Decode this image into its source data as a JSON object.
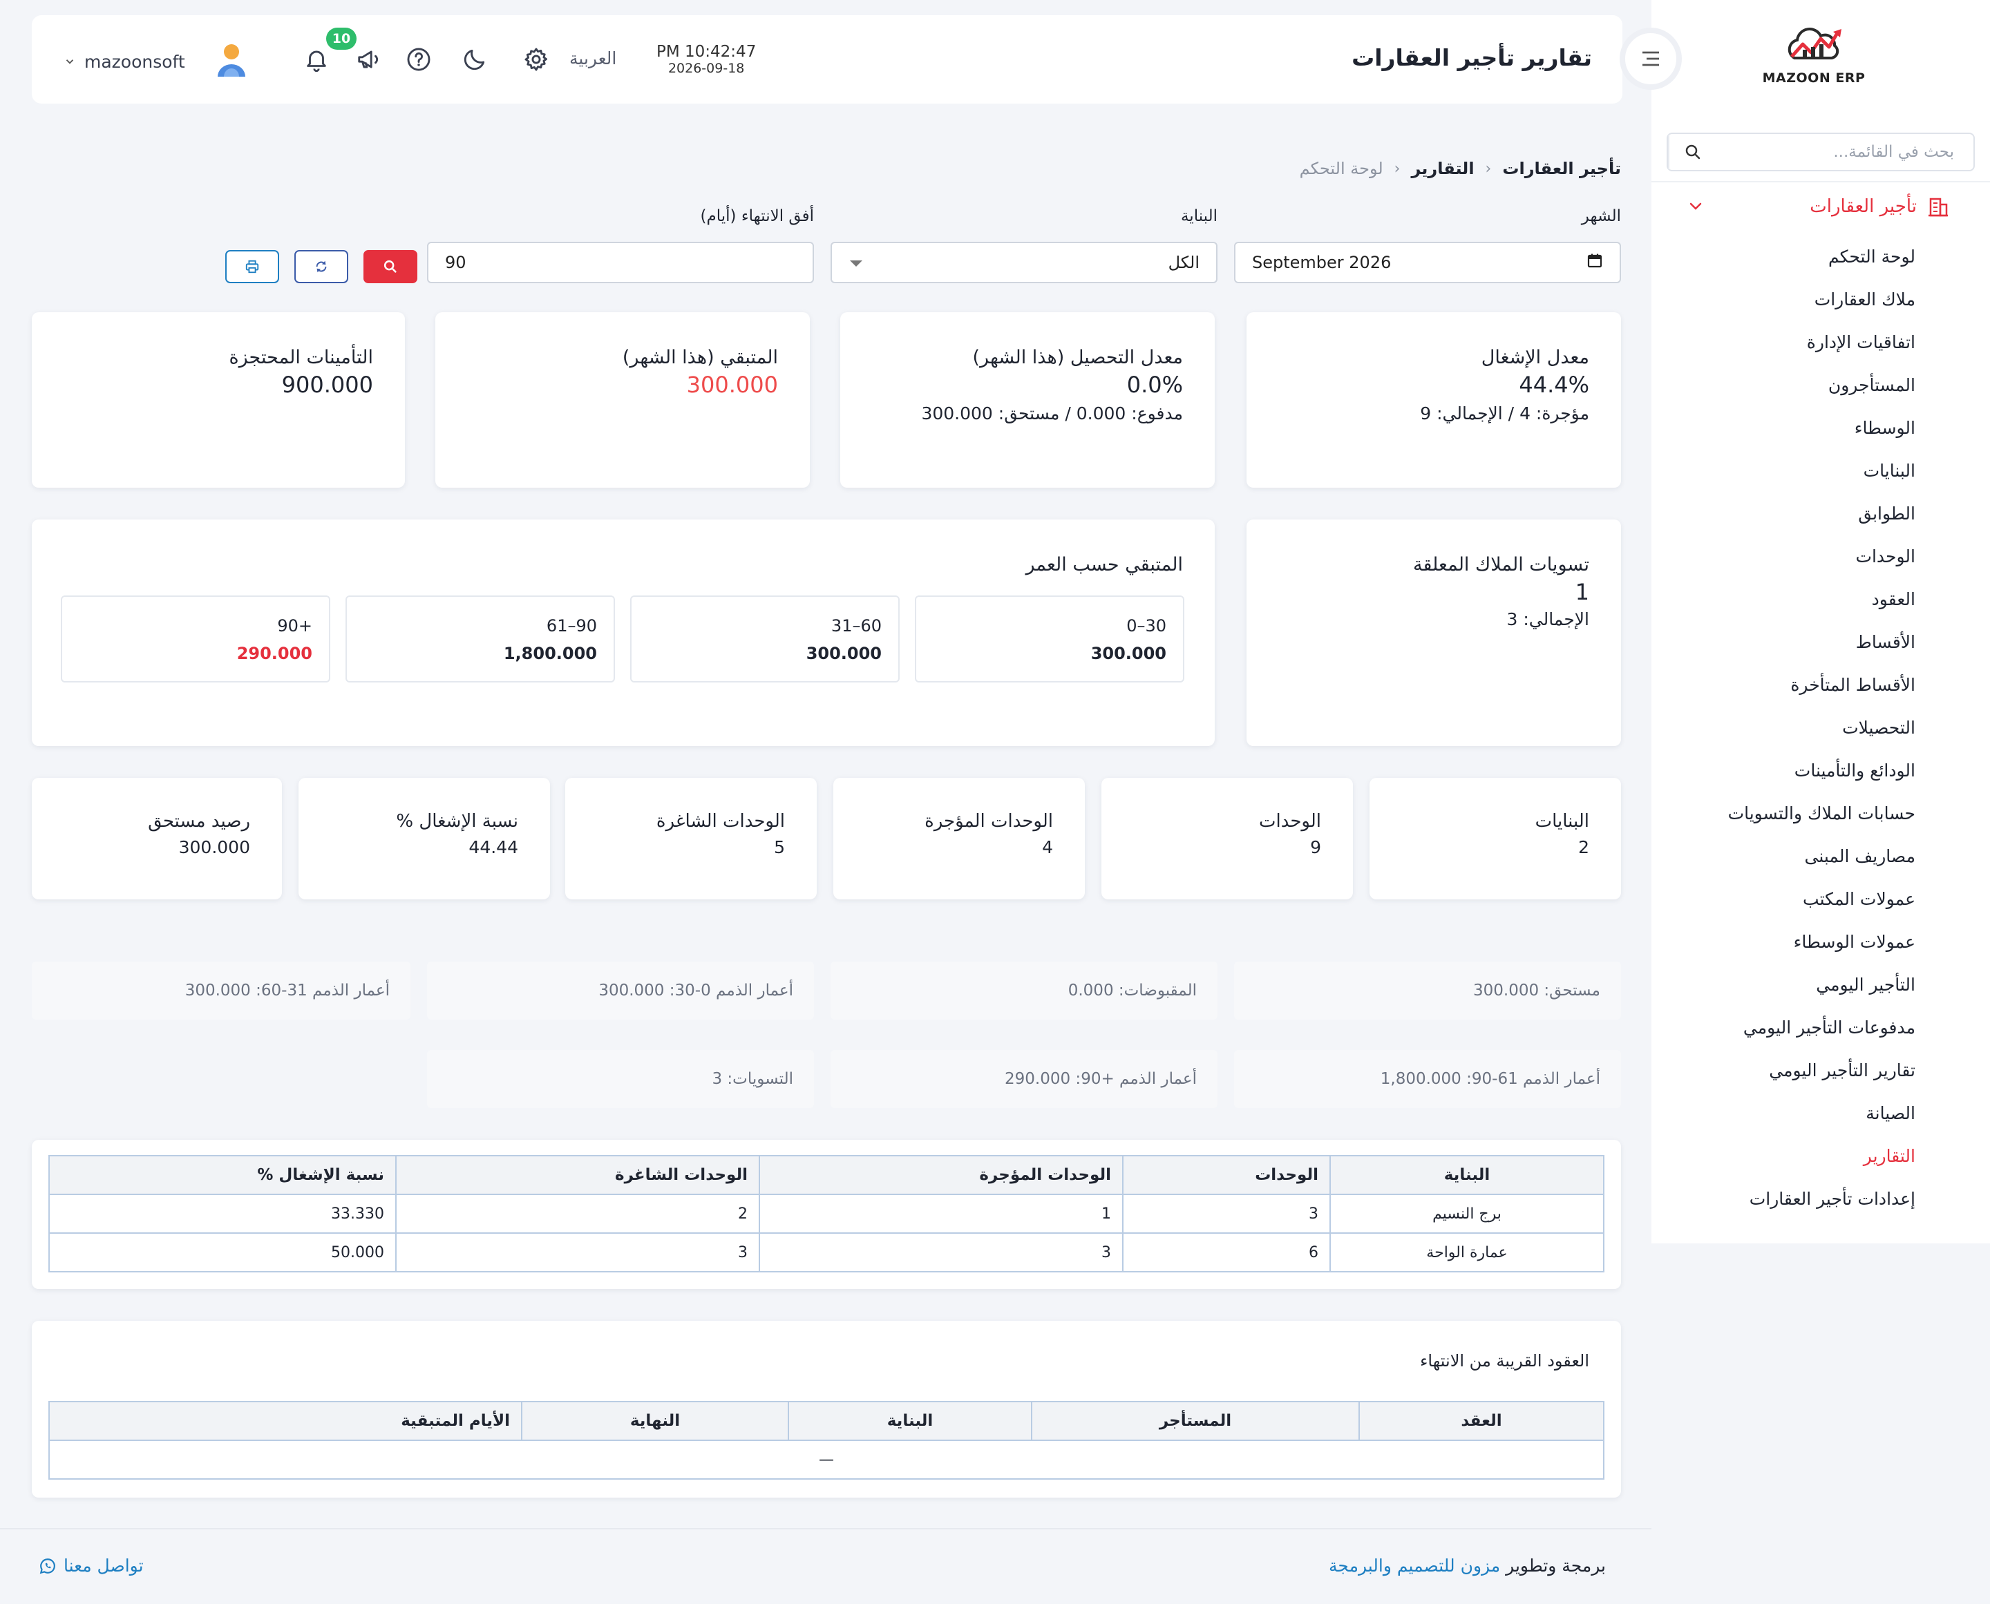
{
  "app": {
    "logo_text": "MAZOON ERP",
    "accent": "#e5303d",
    "link_color": "#1e7fc2"
  },
  "sidebar": {
    "search_placeholder": "بحث في القائمة...",
    "group_label": "تأجير العقارات",
    "items": [
      {
        "label": "لوحة التحكم",
        "active": false
      },
      {
        "label": "ملاك العقارات",
        "active": false
      },
      {
        "label": "اتفاقيات الإدارة",
        "active": false
      },
      {
        "label": "المستأجرون",
        "active": false
      },
      {
        "label": "الوسطاء",
        "active": false
      },
      {
        "label": "البنايات",
        "active": false
      },
      {
        "label": "الطوابق",
        "active": false
      },
      {
        "label": "الوحدات",
        "active": false
      },
      {
        "label": "العقود",
        "active": false
      },
      {
        "label": "الأقساط",
        "active": false
      },
      {
        "label": "الأقساط المتأخرة",
        "active": false
      },
      {
        "label": "التحصيلات",
        "active": false
      },
      {
        "label": "الودائع والتأمينات",
        "active": false
      },
      {
        "label": "حسابات الملاك والتسويات",
        "active": false
      },
      {
        "label": "مصاريف المبنى",
        "active": false
      },
      {
        "label": "عمولات المكتب",
        "active": false
      },
      {
        "label": "عمولات الوسطاء",
        "active": false
      },
      {
        "label": "التأجير اليومي",
        "active": false
      },
      {
        "label": "مدفوعات التأجير اليومي",
        "active": false
      },
      {
        "label": "تقارير التأجير اليومي",
        "active": false
      },
      {
        "label": "الصيانة",
        "active": false
      },
      {
        "label": "التقارير",
        "active": true
      },
      {
        "label": "إعدادات تأجير العقارات",
        "active": false
      }
    ]
  },
  "header": {
    "title": "تقارير تأجير العقارات",
    "time": "PM 10:42:47",
    "date": "2026-09-18",
    "language": "العربية",
    "notification_count": "10",
    "username": "mazoonsoft"
  },
  "breadcrumb": [
    "تأجير العقارات",
    "التقارير",
    "لوحة التحكم"
  ],
  "filters": {
    "month_label": "الشهر",
    "month_value": "September 2026",
    "building_label": "البناية",
    "building_value": "الكل",
    "horizon_label": "أفق الانتهاء (أيام)",
    "horizon_value": "90"
  },
  "kpis": {
    "occupancy": {
      "title": "معدل الإشغال",
      "value": "44.4%",
      "sub": "مؤجرة: 4 / الإجمالي: 9"
    },
    "collection": {
      "title": "معدل التحصيل (هذا الشهر)",
      "value": "0.0%",
      "sub": "مدفوع: 0.000 / مستحق: 300.000"
    },
    "remaining": {
      "title": "المتبقي (هذا الشهر)",
      "value": "300.000"
    },
    "deposits": {
      "title": "التأمينات المحتجزة",
      "value": "900.000"
    }
  },
  "settlements": {
    "title": "تسويات الملاك المعلقة",
    "value": "1",
    "sub": "الإجمالي: 3"
  },
  "aging": {
    "title": "المتبقي حسب العمر",
    "buckets": [
      {
        "label": "0–30",
        "value": "300.000",
        "red": false
      },
      {
        "label": "31–60",
        "value": "300.000",
        "red": false
      },
      {
        "label": "61–90",
        "value": "1,800.000",
        "red": false
      },
      {
        "label": "90+",
        "value": "290.000",
        "red": true
      }
    ]
  },
  "stats": [
    {
      "title": "البنايات",
      "value": "2"
    },
    {
      "title": "الوحدات",
      "value": "9"
    },
    {
      "title": "الوحدات المؤجرة",
      "value": "4"
    },
    {
      "title": "الوحدات الشاغرة",
      "value": "5"
    },
    {
      "title": "نسبة الإشغال %",
      "value": "44.44"
    },
    {
      "title": "رصيد مستحق",
      "value": "300.000"
    }
  ],
  "pills": [
    "مستحق: 300.000",
    "المقبوضات: 0.000",
    "أعمار الذمم 0-30: 300.000",
    "أعمار الذمم 31-60: 300.000",
    "أعمار الذمم 61-90: 1,800.000",
    "أعمار الذمم +90: 290.000",
    "التسويات: 3"
  ],
  "buildings_table": {
    "headers": [
      "البناية",
      "الوحدات",
      "الوحدات المؤجرة",
      "الوحدات الشاغرة",
      "نسبة الإشغال %"
    ],
    "rows": [
      [
        "برج النسيم",
        "3",
        "1",
        "2",
        "33.330"
      ],
      [
        "عمارة الواحة",
        "6",
        "3",
        "3",
        "50.000"
      ]
    ]
  },
  "expiring": {
    "title": "العقود القريبة من الانتهاء",
    "headers": [
      "العقد",
      "المستأجر",
      "البناية",
      "النهاية",
      "الأيام المتبقية"
    ],
    "empty": "—"
  },
  "footer": {
    "prefix": "برمجة وتطوير",
    "brand": "مزون للتصميم والبرمجة",
    "contact": "تواصل معنا"
  }
}
